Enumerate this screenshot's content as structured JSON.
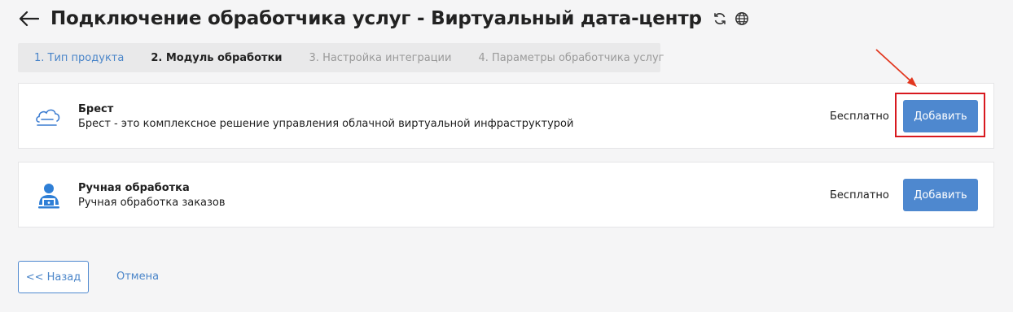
{
  "header": {
    "title": "Подключение обработчика услуг - Виртуальный дата-центр"
  },
  "steps": [
    {
      "label": "1. Тип продукта",
      "state": "done"
    },
    {
      "label": "2. Модуль обработки",
      "state": "active"
    },
    {
      "label": "3. Настройка интеграции",
      "state": "todo"
    },
    {
      "label": "4. Параметры обработчика услуг",
      "state": "todo"
    }
  ],
  "modules": [
    {
      "name": "Брест",
      "description": "Брест - это комплексное решение управления облачной виртуальной инфраструктурой",
      "price": "Бесплатно",
      "button": "Добавить",
      "icon": "cloud-icon"
    },
    {
      "name": "Ручная обработка",
      "description": "Ручная обработка заказов",
      "price": "Бесплатно",
      "button": "Добавить",
      "icon": "operator-laptop-icon"
    }
  ],
  "footer": {
    "back_label": "<< Назад",
    "cancel_label": "Отмена"
  },
  "colors": {
    "accent": "#4e88cf",
    "highlight": "#d8191f"
  }
}
